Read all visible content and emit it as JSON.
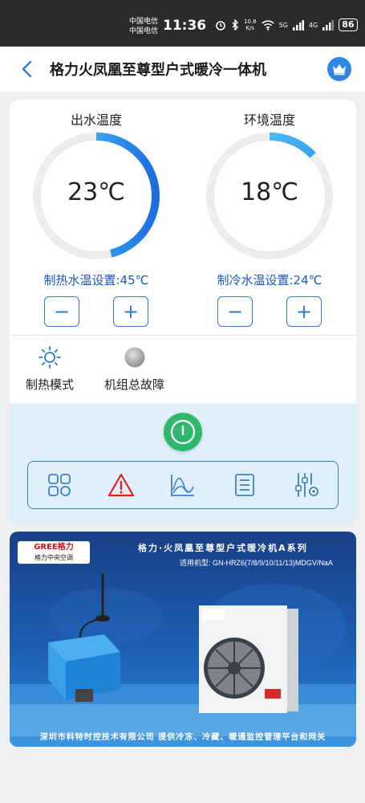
{
  "status_bar": {
    "carrier_1": "中国电信",
    "carrier_2": "中国电信",
    "time": "11:36",
    "net_speed": "10.8",
    "net_unit": "K/s",
    "sig_5g": "5G",
    "sig_4g": "4G",
    "battery": "86"
  },
  "header": {
    "title": "格力火凤凰至尊型户式暖冷一体机",
    "back_icon": "chevron-left-icon",
    "crown_icon": "crown-icon"
  },
  "gauges": [
    {
      "label": "出水温度",
      "value": "23℃",
      "fraction": 0.46,
      "setpoint": "制热水温设置:45℃"
    },
    {
      "label": "环境温度",
      "value": "18℃",
      "fraction": 0.13,
      "setpoint": "制冷水温设置:24℃"
    }
  ],
  "controls": {
    "minus": "−",
    "plus": "+"
  },
  "status_items": [
    {
      "label": "制热模式",
      "icon": "sun-icon"
    },
    {
      "label": "机组总故障",
      "icon": "status-dot-icon"
    }
  ],
  "colors": {
    "accent": "#2e7bd6",
    "arc_start": "#1a6ee0",
    "arc_end": "#5bd3ff",
    "power": "#2fb86b",
    "alarm": "#e02020"
  },
  "toolbar": [
    "grid-icon",
    "warning-icon",
    "chart-icon",
    "list-icon",
    "sliders-icon"
  ],
  "banner": {
    "logo_text": "GREE格力",
    "logo_sub": "格力中央空调",
    "title": "格力·火凤凰至尊型户式暖冷机A系列",
    "model_label": "适用机型:",
    "model": "GN-HRZ6(7/8/9/10/11/13)MDGV/NaA",
    "footer": "深圳市科特时控技术有限公司   提供冷冻、冷藏、暖通监控管理平台和网关"
  }
}
